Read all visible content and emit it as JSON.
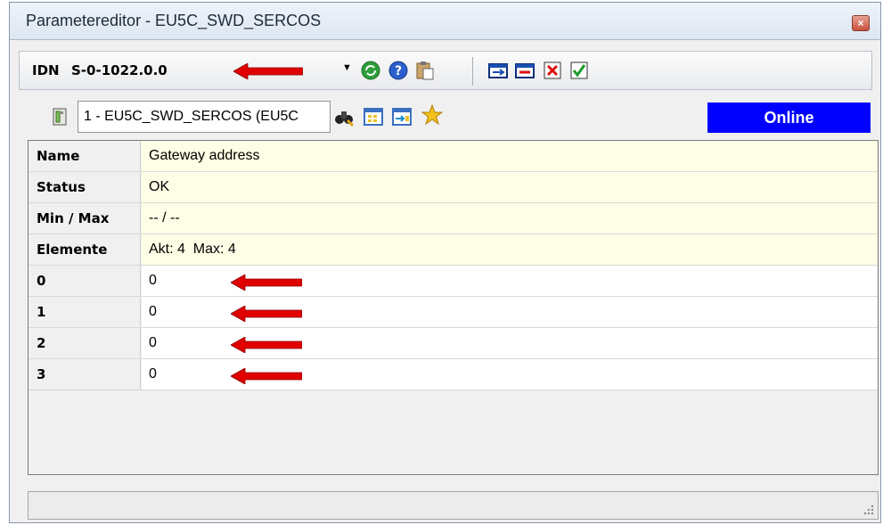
{
  "window": {
    "title": "Parametereditor - EU5C_SWD_SERCOS",
    "close_icon": "×"
  },
  "toolbar": {
    "idn_label": "IDN",
    "idn_value": "S-0-1022.0.0",
    "dropdown_glyph": "▼",
    "icons": [
      "refresh-icon",
      "help-icon",
      "paste-icon",
      "add-parameter-icon",
      "remove-parameter-icon",
      "delete-icon",
      "accept-icon"
    ]
  },
  "device_bar": {
    "device_icon": "device-icon",
    "device_value": "1 - EU5C_SWD_SERCOS (EU5C",
    "icons": [
      "binoculars-icon",
      "list-icon",
      "import-icon",
      "star-icon"
    ],
    "status": "Online",
    "status_color": "#0000ff"
  },
  "parameter": {
    "rows": [
      {
        "key": "Name",
        "value": "Gateway address"
      },
      {
        "key": "Status",
        "value": "OK"
      },
      {
        "key": "Min / Max",
        "value": "-- / --"
      },
      {
        "key": "Elemente",
        "value": "Akt: 4  Max: 4"
      }
    ],
    "elements": [
      {
        "key": "0",
        "value": "0"
      },
      {
        "key": "1",
        "value": "0"
      },
      {
        "key": "2",
        "value": "0"
      },
      {
        "key": "3",
        "value": "0"
      }
    ]
  },
  "annotations": {
    "arrow_color": "#e00000"
  }
}
